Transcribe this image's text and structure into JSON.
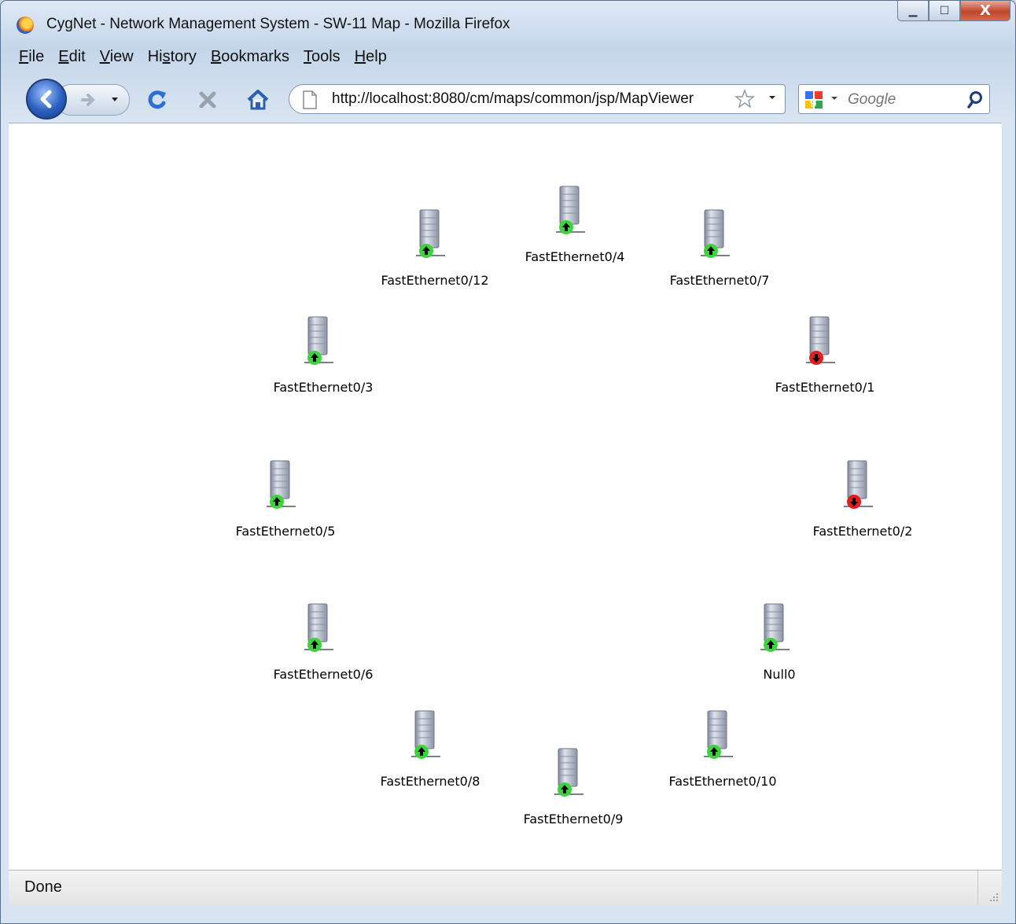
{
  "window": {
    "title": "CygNet - Network Management System - SW-11 Map - Mozilla Firefox",
    "minimize_glyph": "▁",
    "maximize_glyph": "☐",
    "close_glyph": "X"
  },
  "menu": [
    {
      "underline": "F",
      "rest": "ile"
    },
    {
      "underline": "E",
      "rest": "dit"
    },
    {
      "underline": "V",
      "rest": "iew"
    },
    {
      "pre": "Hi",
      "underline": "s",
      "rest": "tory"
    },
    {
      "underline": "B",
      "rest": "ookmarks"
    },
    {
      "underline": "T",
      "rest": "ools"
    },
    {
      "underline": "H",
      "rest": "elp"
    }
  ],
  "toolbar": {
    "url": "http://localhost:8080/cm/maps/common/jsp/MapViewer",
    "search_placeholder": "Google"
  },
  "colors": {
    "status_up": "#3cd43c",
    "status_down": "#e41e1e"
  },
  "nodes": [
    {
      "label": "FastEthernet0/4",
      "status": "up"
    },
    {
      "label": "FastEthernet0/12",
      "status": "up"
    },
    {
      "label": "FastEthernet0/7",
      "status": "up"
    },
    {
      "label": "FastEthernet0/3",
      "status": "up"
    },
    {
      "label": "FastEthernet0/1",
      "status": "down"
    },
    {
      "label": "FastEthernet0/5",
      "status": "up"
    },
    {
      "label": "FastEthernet0/2",
      "status": "down"
    },
    {
      "label": "FastEthernet0/6",
      "status": "up"
    },
    {
      "label": "Null0",
      "status": "up"
    },
    {
      "label": "FastEthernet0/8",
      "status": "up"
    },
    {
      "label": "FastEthernet0/10",
      "status": "up"
    },
    {
      "label": "FastEthernet0/9",
      "status": "up"
    }
  ],
  "status": {
    "text": "Done"
  }
}
